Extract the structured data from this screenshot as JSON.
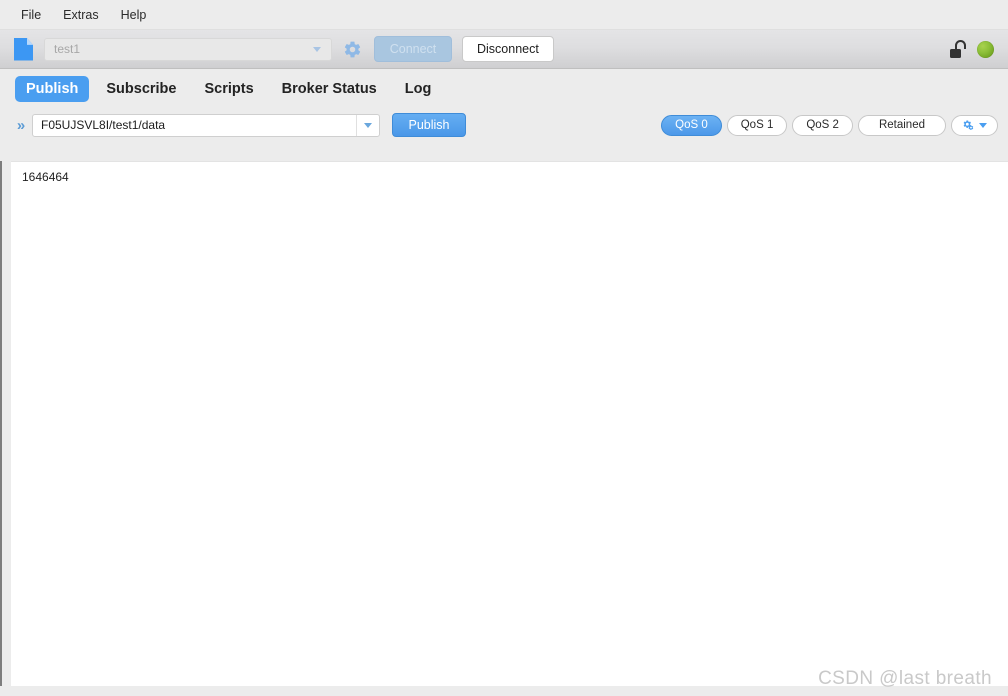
{
  "menubar": {
    "items": [
      {
        "label": "File"
      },
      {
        "label": "Extras"
      },
      {
        "label": "Help"
      }
    ]
  },
  "toolbar": {
    "file_icon": "file-icon",
    "connection": {
      "value": "test1",
      "placeholder": "test1",
      "caret_icon": "chevron-down-icon"
    },
    "settings_icon": "gear-icon",
    "connect_label": "Connect",
    "disconnect_label": "Disconnect",
    "lock_icon": "unlocked-padlock-icon",
    "status_icon": "connected-status-led",
    "status_color": "#8cbf38"
  },
  "tabs": [
    {
      "label": "Publish",
      "active": true
    },
    {
      "label": "Subscribe",
      "active": false
    },
    {
      "label": "Scripts",
      "active": false
    },
    {
      "label": "Broker Status",
      "active": false
    },
    {
      "label": "Log",
      "active": false
    }
  ],
  "publish_row": {
    "expand_icon": "double-chevron-right-icon",
    "topic": {
      "value": "F05UJSVL8I/test1/data",
      "caret_icon": "chevron-down-icon"
    },
    "publish_label": "Publish",
    "qos_options": [
      {
        "label": "QoS 0",
        "active": true
      },
      {
        "label": "QoS 1",
        "active": false
      },
      {
        "label": "QoS 2",
        "active": false
      }
    ],
    "retained_label": "Retained",
    "settings_icon": "gears-dropdown-icon"
  },
  "editor": {
    "payload": "1646464"
  },
  "watermark": {
    "text": "CSDN @last breath"
  },
  "colors": {
    "accent": "#4a9ef0",
    "toolbar_top": "#e4e4e6",
    "toolbar_bottom": "#cfcfd1",
    "window_bg": "#ececec",
    "status_green": "#8cbf38"
  }
}
